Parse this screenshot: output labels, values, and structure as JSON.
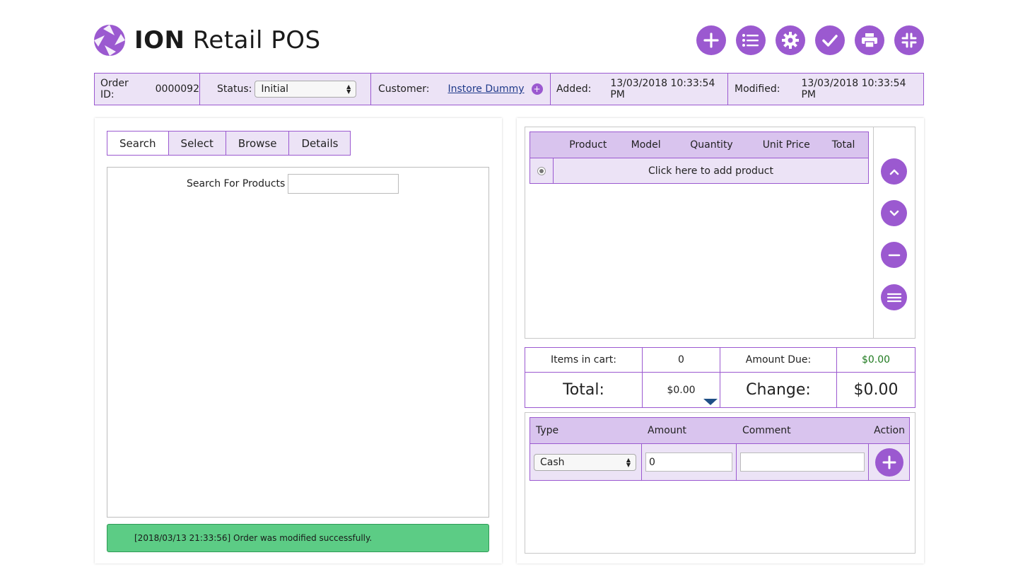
{
  "app": {
    "title_bold": "ION",
    "title_rest": "Retail POS",
    "accent_color": "#9b59d0"
  },
  "toolbar": {
    "buttons": [
      {
        "icon": "plus-icon"
      },
      {
        "icon": "list-icon"
      },
      {
        "icon": "gear-icon"
      },
      {
        "icon": "check-icon"
      },
      {
        "icon": "print-icon"
      },
      {
        "icon": "compress-icon"
      }
    ]
  },
  "order": {
    "id_label": "Order ID:",
    "id_value": "0000092",
    "status_label": "Status:",
    "status_value": "Initial",
    "customer_label": "Customer:",
    "customer_value": "Instore Dummy",
    "added_label": "Added:",
    "added_value": "13/03/2018 10:33:54 PM",
    "modified_label": "Modified:",
    "modified_value": "13/03/2018 10:33:54 PM"
  },
  "left": {
    "tabs": [
      "Search",
      "Select",
      "Browse",
      "Details"
    ],
    "search_label": "Search For Products",
    "search_value": "",
    "status_message": "[2018/03/13 21:33:56] Order was modified successfully."
  },
  "cart": {
    "columns": [
      "Product",
      "Model",
      "Quantity",
      "Unit Price",
      "Total"
    ],
    "add_row_text": "Click here to add product",
    "side_buttons": [
      "chevron-up-icon",
      "chevron-down-icon",
      "minus-icon",
      "menu-icon"
    ]
  },
  "totals": {
    "items_label": "Items in cart:",
    "items_value": "0",
    "amount_due_label": "Amount Due:",
    "amount_due_value": "$0.00",
    "total_label": "Total:",
    "total_value": "$0.00",
    "change_label": "Change:",
    "change_value": "$0.00"
  },
  "payment": {
    "columns": [
      "Type",
      "Amount",
      "Comment",
      "Action"
    ],
    "type_value": "Cash",
    "amount_value": "0",
    "comment_value": ""
  }
}
